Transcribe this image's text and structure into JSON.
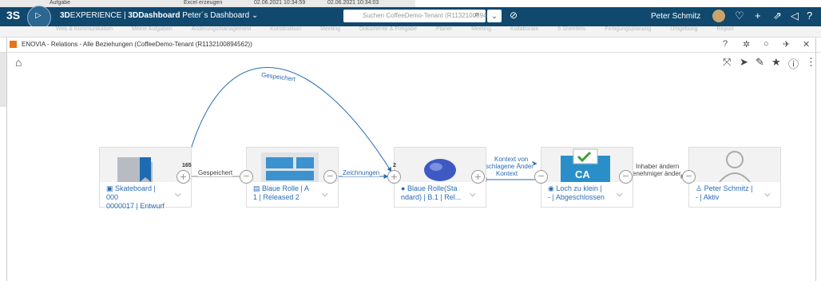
{
  "bg_window": {
    "col1": "Aufgabe",
    "col2": "Excel erzeugen",
    "col3": "02.06.2021 10:34:59",
    "col4": "02.06.2021 10:34:03"
  },
  "topbar": {
    "brand_bold": "3D",
    "brand": "EXPERIENCE | ",
    "app": "3DDashboard",
    "dashboard": " Peter´s Dashboard",
    "compass_version": "V.R",
    "search_placeholder": "Suchen CoffeeDemo-Tenant (R1132100894562)",
    "user": "Peter Schmitz",
    "notif_count": "9"
  },
  "tabs": [
    "Web & Kommunikation",
    "Meine Aufgaben",
    "Änderungsmanagement",
    "Konstruktion",
    "Meeting",
    "Dokumente & Freigabe",
    "Planer",
    "Meeting",
    "Kollaborate",
    "6 Sheetlets",
    "Fertigungsplanung",
    "Umgebung",
    "Report"
  ],
  "widget": {
    "title": "ENOVIA - Relations - Alle Beziehungen (CoffeeDemo-Tenant (R1132100894562))"
  },
  "nodes": [
    {
      "line1": "Skateboard | 000",
      "line2": "0000017 | Entwurf",
      "count": "165"
    },
    {
      "line1": "Blaue Rolle | A",
      "line2": "1 | Released 2"
    },
    {
      "line1": "Blaue Rolle(Sta",
      "line2": "ndard) | B.1 | Rel...",
      "count": "2"
    },
    {
      "line1": "Loch zu klein |",
      "line2": "- | Abgeschlossen"
    },
    {
      "line1": "Peter Schmitz |",
      "line2": "- | Aktiv"
    }
  ],
  "edges": {
    "arc": "Gespeichert",
    "e1": "Gespeichert",
    "e2": "Zeichnungen",
    "e3a": "Kontext von",
    "e3b": "geschlagene Änder",
    "e3c": "Kontext",
    "e4a": "Inhaber ändern",
    "e4b": "enehmiger änder"
  },
  "colors": {
    "topbar": "#10486e",
    "link": "#2a6cb5",
    "widget_icon": "#e8731c",
    "ca_badge": "#3aa23a"
  }
}
